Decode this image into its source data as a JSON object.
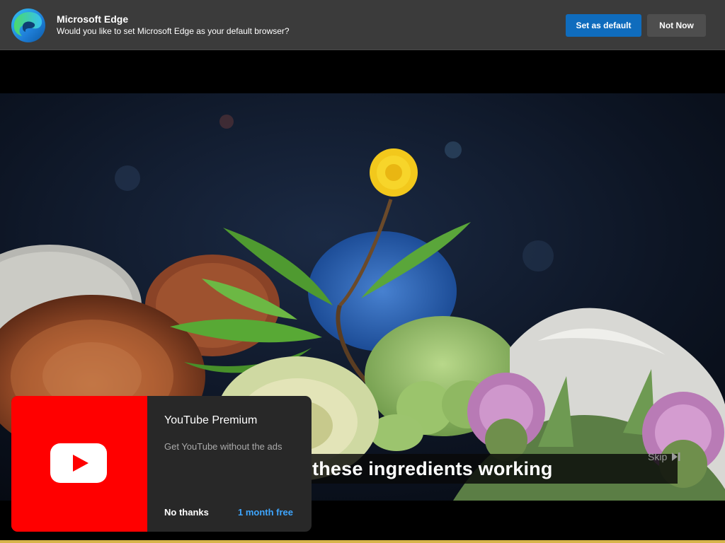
{
  "edge_prompt": {
    "title": "Microsoft Edge",
    "message": "Would you like to set Microsoft Edge as your default browser?",
    "primary_button": "Set as default",
    "secondary_button": "Not Now",
    "icon": "edge-logo-icon"
  },
  "video": {
    "caption": "these ingredients working",
    "skip_label": "Skip",
    "skip_icon": "skip-next-icon"
  },
  "premium_promo": {
    "title": "YouTube Premium",
    "subtitle": "Get YouTube without the ads",
    "decline_label": "No thanks",
    "accept_label": "1 month free",
    "icon": "youtube-play-icon",
    "accent_color": "#ff0000",
    "link_color": "#3ea6ff"
  },
  "colors": {
    "edge_bar": "#3b3b3b",
    "primary_button": "#0f6cbd",
    "secondary_button": "#4e4e4e"
  }
}
